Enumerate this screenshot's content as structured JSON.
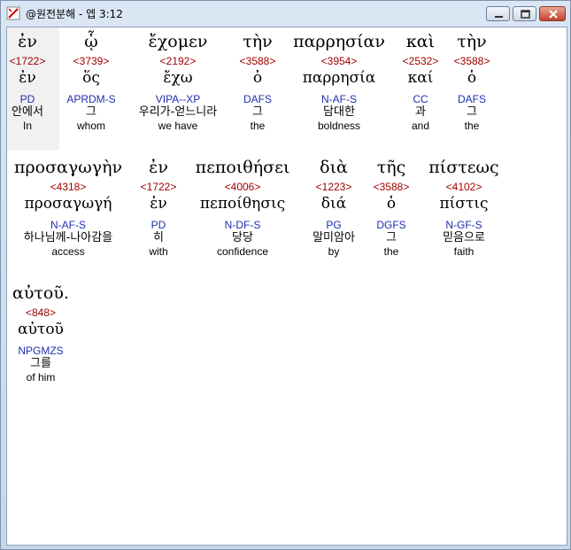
{
  "window": {
    "title": "@원전분해 - 엡 3:12",
    "minimize": "minimize",
    "maximize": "maximize",
    "close": "close"
  },
  "words": [
    {
      "greek": "ἐν",
      "num": "<1722>",
      "lemma": "ἐν",
      "parse": "PD",
      "korean": "안에서",
      "english": "In"
    },
    {
      "greek": "ᾧ",
      "num": "<3739>",
      "lemma": "ὅς",
      "parse": "APRDM-S",
      "korean": "그",
      "english": "whom"
    },
    {
      "greek": "ἔχομεν",
      "num": "<2192>",
      "lemma": "ἔχω",
      "parse": "VIPA--XP",
      "korean": "우리가-얻느니라",
      "english": "we have"
    },
    {
      "greek": "τὴν",
      "num": "<3588>",
      "lemma": "ὁ",
      "parse": "DAFS",
      "korean": "그",
      "english": "the"
    },
    {
      "greek": "παρρησίαν",
      "num": "<3954>",
      "lemma": "παρρησία",
      "parse": "N-AF-S",
      "korean": "담대한",
      "english": "boldness"
    },
    {
      "greek": "καὶ",
      "num": "<2532>",
      "lemma": "καί",
      "parse": "CC",
      "korean": "과",
      "english": "and"
    },
    {
      "greek": "τὴν",
      "num": "<3588>",
      "lemma": "ὁ",
      "parse": "DAFS",
      "korean": "그",
      "english": "the"
    },
    {
      "greek": "προσαγωγὴν",
      "num": "<4318>",
      "lemma": "προσαγωγή",
      "parse": "N-AF-S",
      "korean": "하나님께-나아감을",
      "english": "access"
    },
    {
      "greek": "ἐν",
      "num": "<1722>",
      "lemma": "ἐν",
      "parse": "PD",
      "korean": "히",
      "english": "with"
    },
    {
      "greek": "πεποιθήσει",
      "num": "<4006>",
      "lemma": "πεποίθησις",
      "parse": "N-DF-S",
      "korean": "당당",
      "english": "confidence"
    },
    {
      "greek": "διὰ",
      "num": "<1223>",
      "lemma": "διά",
      "parse": "PG",
      "korean": "말미암아",
      "english": "by"
    },
    {
      "greek": "τῆς",
      "num": "<3588>",
      "lemma": "ὁ",
      "parse": "DGFS",
      "korean": "그",
      "english": "the"
    },
    {
      "greek": "πίστεως",
      "num": "<4102>",
      "lemma": "πίστις",
      "parse": "N-GF-S",
      "korean": "믿음으로",
      "english": "faith"
    },
    {
      "greek": "αὐτοῦ.",
      "num": "<848>",
      "lemma": "αὐτοῦ",
      "parse": "NPGMZS",
      "korean": "그를",
      "english": "of him"
    }
  ]
}
